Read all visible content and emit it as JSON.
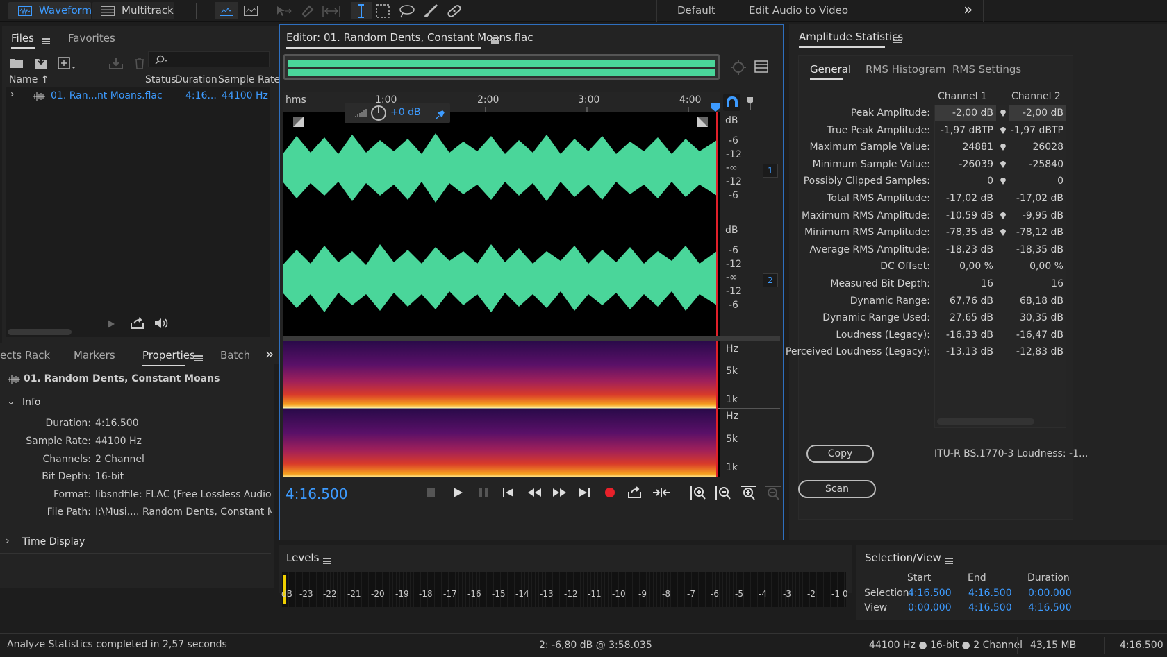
{
  "toolbar": {
    "waveform_label": "Waveform",
    "multitrack_label": "Multitrack",
    "workspace_default": "Default",
    "workspace_edit": "Edit Audio to Video",
    "more": "»"
  },
  "files_panel": {
    "tab_files": "Files",
    "tab_favorites": "Favorites",
    "col_name": "Name ↑",
    "col_status": "Status",
    "col_duration": "Duration",
    "col_sample_rate": "Sample Rate",
    "file_name": "01. Ran...nt Moans.flac",
    "file_duration": "4:16...",
    "file_rate": "44100 Hz"
  },
  "lower_left": {
    "tab_effects": "ects Rack",
    "tab_markers": "Markers",
    "tab_properties": "Properties",
    "tab_batch": "Batch",
    "more": "»",
    "title": "01. Random Dents, Constant Moans",
    "info_label": "Info",
    "props": [
      {
        "k": "Duration:",
        "v": "4:16.500"
      },
      {
        "k": "Sample Rate:",
        "v": "44100 Hz"
      },
      {
        "k": "Channels:",
        "v": "2 Channel"
      },
      {
        "k": "Bit Depth:",
        "v": "16-bit"
      },
      {
        "k": "Format:",
        "v": "libsndfile: FLAC (Free Lossless Audio Codec),..."
      },
      {
        "k": "File Path:",
        "v": "I:\\Musi.... Random Dents, Constant Moans.flac"
      }
    ],
    "time_display": "Time Display"
  },
  "editor": {
    "title": "Editor: 01. Random Dents, Constant Moans.flac",
    "ruler_unit": "hms",
    "ruler_ticks": [
      "1:00",
      "2:00",
      "3:00",
      "4:00"
    ],
    "hud_gain": "+0 dB",
    "db_label": "dB",
    "db_scale": [
      "-6",
      "-12",
      "-∞",
      "-12",
      "-6"
    ],
    "ch1": "1",
    "ch2": "2",
    "hz_label": "Hz",
    "hz_scale": [
      "5k",
      "1k"
    ],
    "time": "4:16.500"
  },
  "amp": {
    "title": "Amplitude Statistics",
    "tab_general": "General",
    "tab_hist": "RMS Histogram",
    "tab_settings": "RMS Settings",
    "ch1": "Channel 1",
    "ch2": "Channel 2",
    "rows": [
      {
        "label": "Peak Amplitude:",
        "c1": "-2,00 dB",
        "c2": "-2,00 dB",
        "pin": true
      },
      {
        "label": "True Peak Amplitude:",
        "c1": "-1,97 dBTP",
        "c2": "-1,97 dBTP",
        "pin": true
      },
      {
        "label": "Maximum Sample Value:",
        "c1": "24881",
        "c2": "26028",
        "pin": true
      },
      {
        "label": "Minimum Sample Value:",
        "c1": "-26039",
        "c2": "-25840",
        "pin": true
      },
      {
        "label": "Possibly Clipped Samples:",
        "c1": "0",
        "c2": "0",
        "pin": true
      },
      {
        "label": "Total RMS Amplitude:",
        "c1": "-17,02 dB",
        "c2": "-17,02 dB",
        "pin": false
      },
      {
        "label": "Maximum RMS Amplitude:",
        "c1": "-10,59 dB",
        "c2": "-9,95 dB",
        "pin": true
      },
      {
        "label": "Minimum RMS Amplitude:",
        "c1": "-78,35 dB",
        "c2": "-78,12 dB",
        "pin": true
      },
      {
        "label": "Average RMS Amplitude:",
        "c1": "-18,23 dB",
        "c2": "-18,35 dB",
        "pin": false
      },
      {
        "label": "DC Offset:",
        "c1": "0,00 %",
        "c2": "0,00 %",
        "pin": false
      },
      {
        "label": "Measured Bit Depth:",
        "c1": "16",
        "c2": "16",
        "pin": false
      },
      {
        "label": "Dynamic Range:",
        "c1": "67,76 dB",
        "c2": "68,18 dB",
        "pin": false
      },
      {
        "label": "Dynamic Range Used:",
        "c1": "27,65 dB",
        "c2": "30,35 dB",
        "pin": false
      },
      {
        "label": "Loudness (Legacy):",
        "c1": "-16,33 dB",
        "c2": "-16,47 dB",
        "pin": false
      },
      {
        "label": "Perceived Loudness (Legacy):",
        "c1": "-13,13 dB",
        "c2": "-12,83 dB",
        "pin": false
      }
    ],
    "copy": "Copy",
    "itu": "ITU-R BS.1770-3 Loudness: -1...",
    "scan": "Scan"
  },
  "levels": {
    "title": "Levels",
    "scale": [
      "dB",
      "-23",
      "-22",
      "-21",
      "-20",
      "-19",
      "-18",
      "-17",
      "-16",
      "-15",
      "-14",
      "-13",
      "-12",
      "-11",
      "-10",
      "-9",
      "-8",
      "-7",
      "-6",
      "-5",
      "-4",
      "-3",
      "-2",
      "-1",
      "0"
    ]
  },
  "selview": {
    "title": "Selection/View",
    "start": "Start",
    "end": "End",
    "duration": "Duration",
    "selection": "Selection",
    "view": "View",
    "sel_start": "4:16.500",
    "sel_end": "4:16.500",
    "sel_dur": "0:00.000",
    "view_start": "0:00.000",
    "view_end": "4:16.500",
    "view_dur": "4:16.500"
  },
  "status": {
    "left": "Analyze Statistics completed in 2,57 seconds",
    "cursor": "2: -6,80 dB @ 3:58.035",
    "format": "44100 Hz ● 16-bit ● 2 Channel",
    "size": "43,15 MB",
    "duration": "4:16.500"
  }
}
